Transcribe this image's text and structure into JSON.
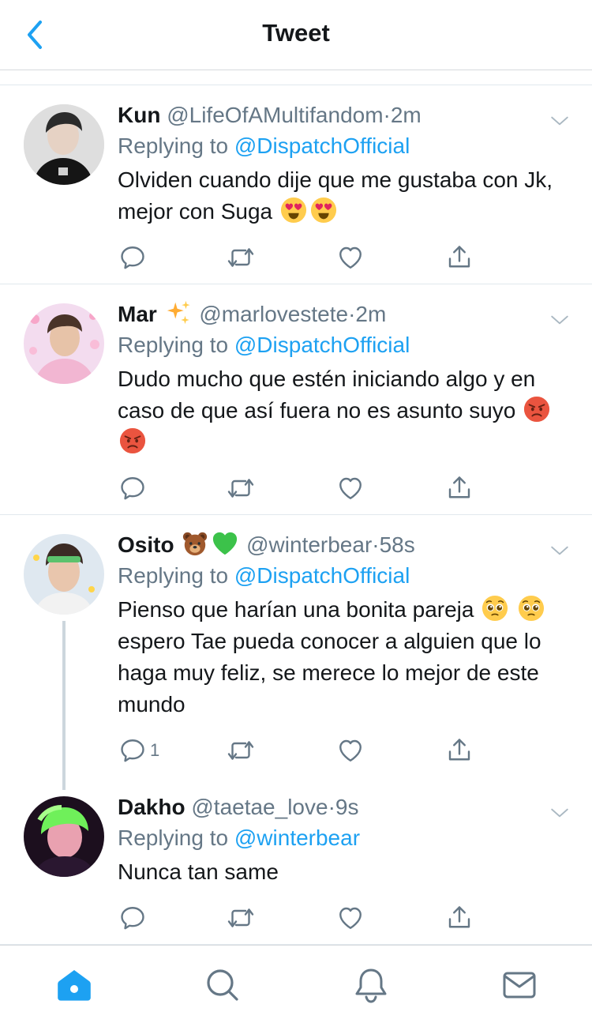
{
  "header": {
    "title": "Tweet"
  },
  "tweets": [
    {
      "name": "Kun",
      "name_emojis": [],
      "handle": "@LifeOfAMultifandom",
      "time": "2m",
      "replying_prefix": "Replying to",
      "replying_to": "@DispatchOfficial",
      "text": "Olviden cuando dije que me gustaba con Jk, mejor con Suga",
      "text_emojis": [
        "heart-eyes",
        "heart-eyes"
      ],
      "reply_count": ""
    },
    {
      "name": "Mar",
      "name_emojis": [
        "sparkles"
      ],
      "handle": "@marlovestete",
      "time": "2m",
      "replying_prefix": "Replying to",
      "replying_to": "@DispatchOfficial",
      "text": "Dudo mucho que estén iniciando algo y en caso de que así fuera no es asunto suyo",
      "text_emojis": [
        "angry-face",
        "angry-face"
      ],
      "reply_count": ""
    },
    {
      "name": "Osito",
      "name_emojis": [
        "bear",
        "green-heart"
      ],
      "handle": "@winterbear",
      "time": "58s",
      "replying_prefix": "Replying to",
      "replying_to": "@DispatchOfficial",
      "text_a": "Pienso que harían una bonita pareja",
      "text_b": "espero Tae pueda conocer a alguien que lo haga muy feliz, se merece lo mejor de este mundo",
      "text_emojis": [
        "pleading-face",
        "pleading-face"
      ],
      "reply_count": "1"
    },
    {
      "name": "Dakho",
      "name_emojis": [],
      "handle": "@taetae_love",
      "time": "9s",
      "replying_prefix": "Replying to",
      "replying_to": "@winterbear",
      "text": "Nunca tan same",
      "text_emojis": [],
      "reply_count": ""
    }
  ],
  "tabbar": {
    "items": [
      "home-icon",
      "search-icon",
      "notifications-icon",
      "messages-icon"
    ],
    "active": "home-icon"
  },
  "colors": {
    "accent": "#1da1f2",
    "secondary_text": "#657786",
    "divider": "#e1e8ed"
  }
}
